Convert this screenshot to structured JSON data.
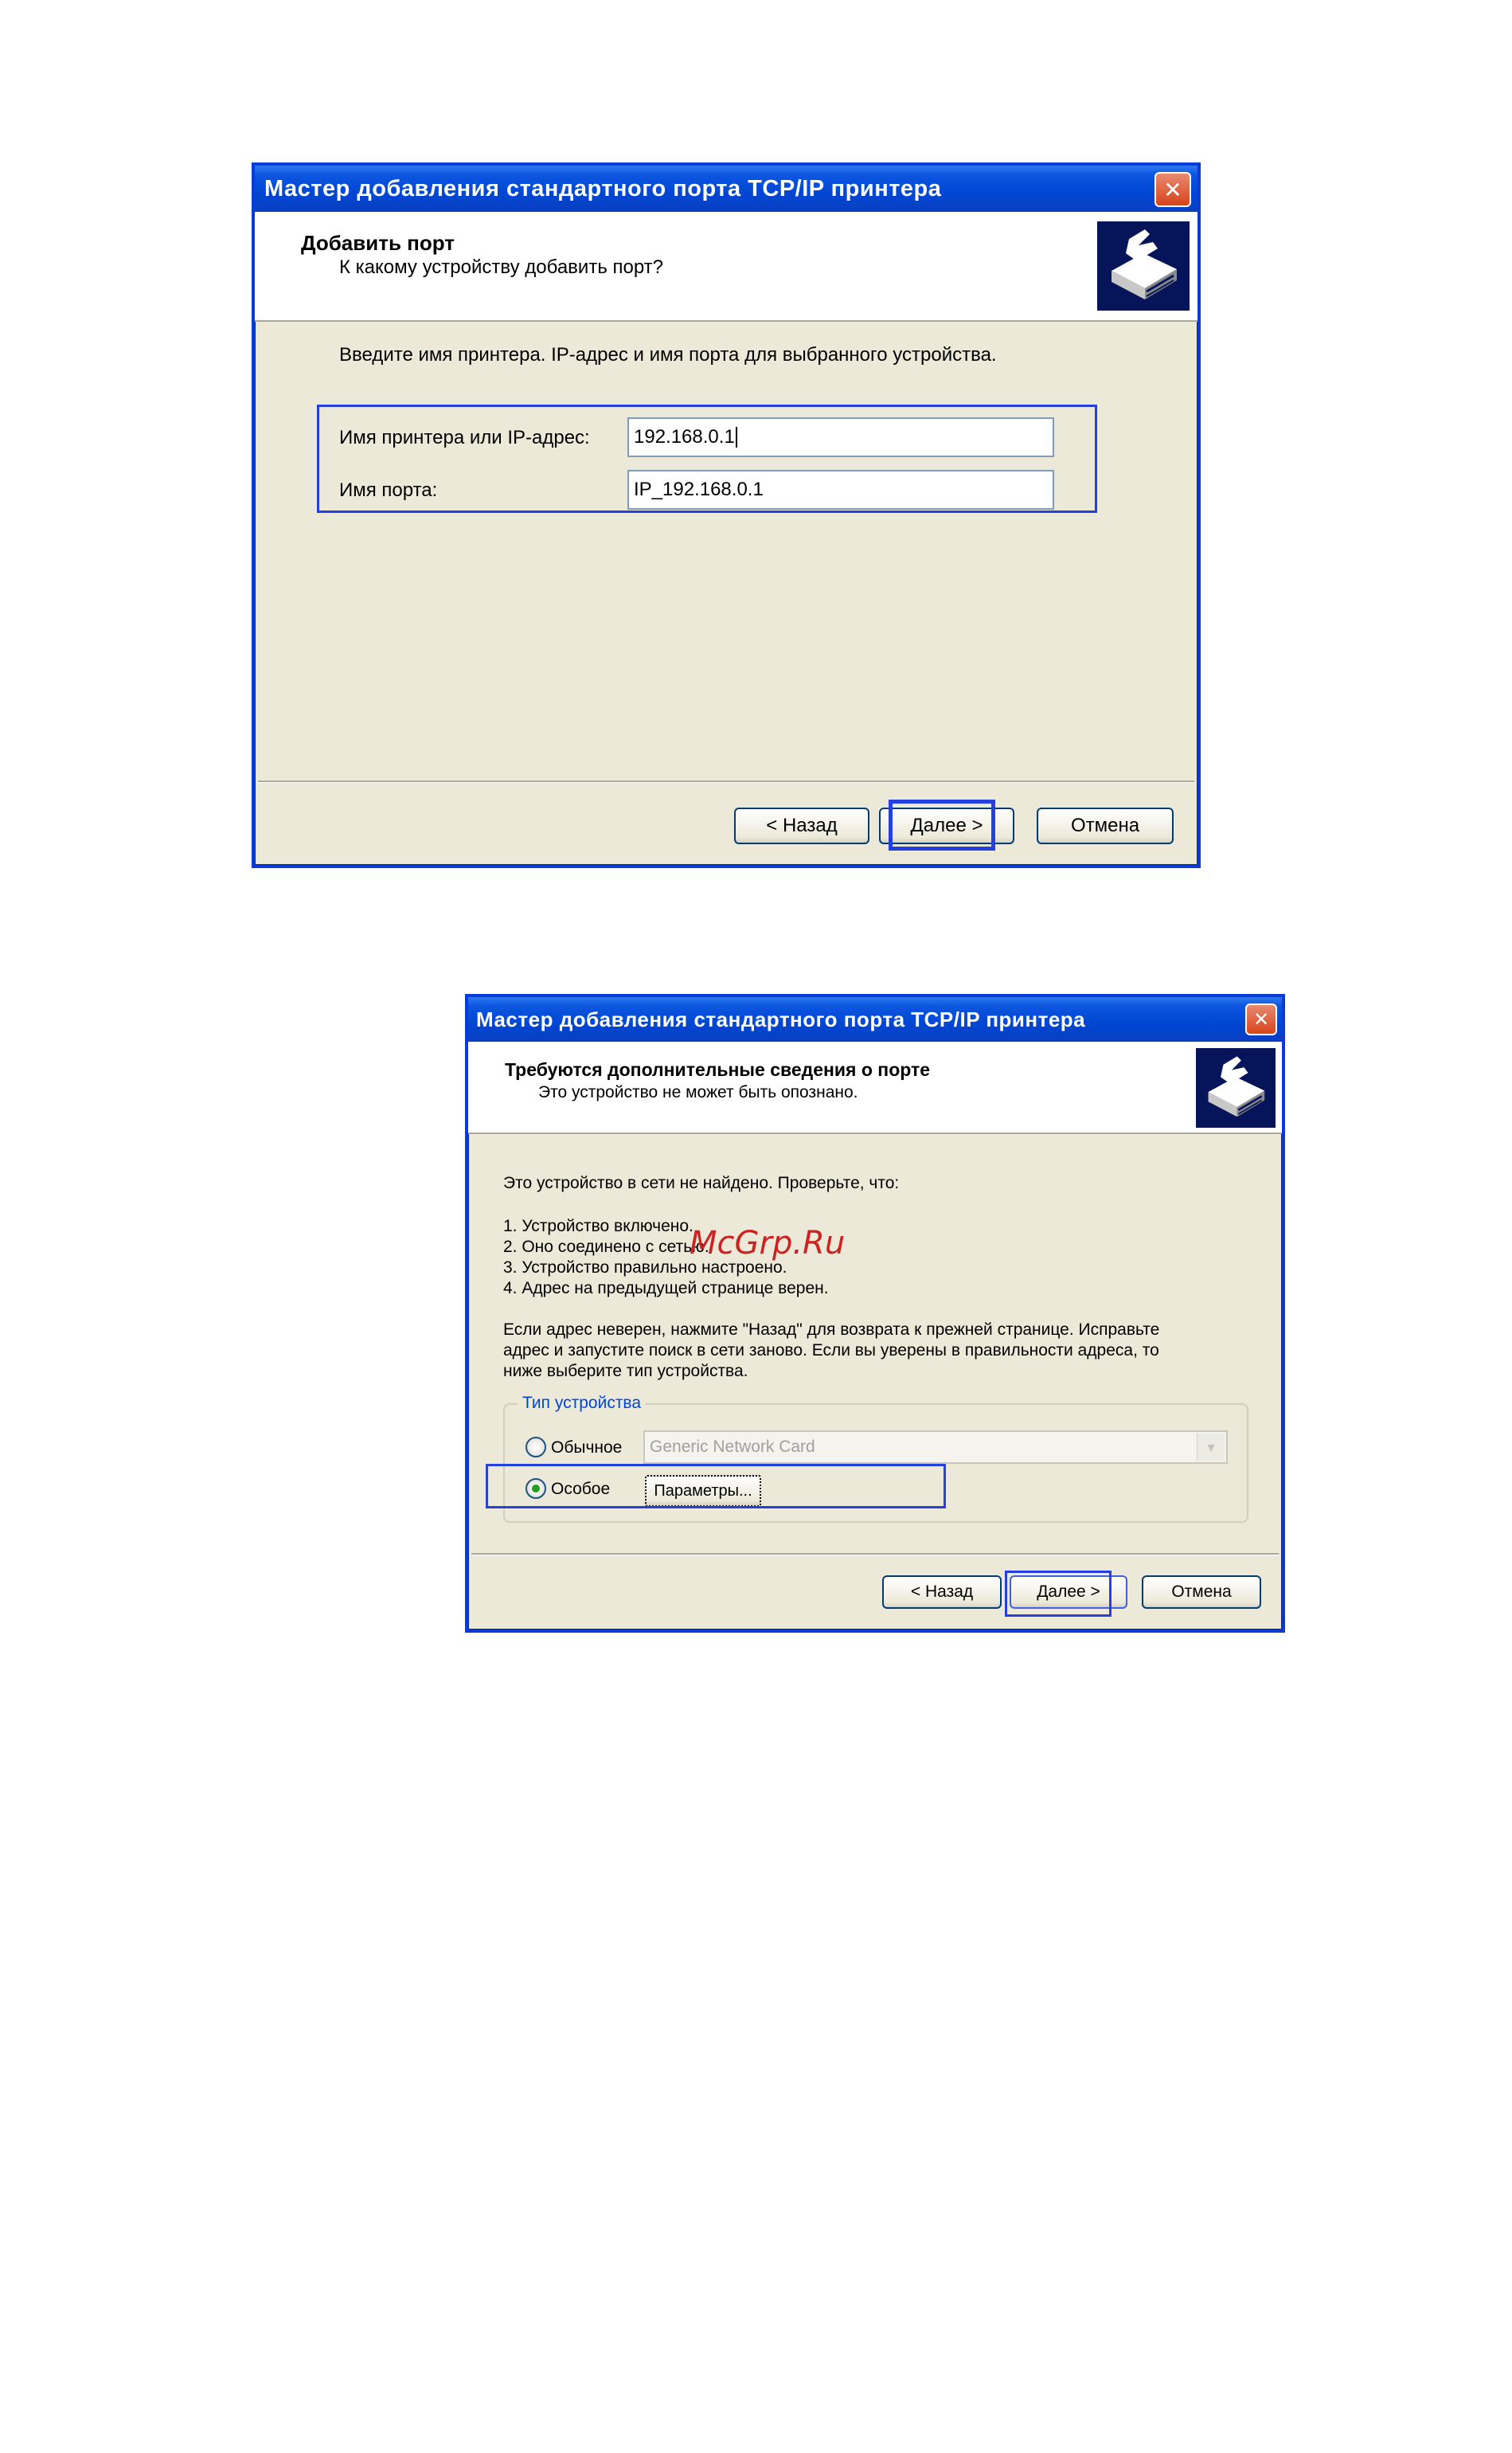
{
  "dialog1": {
    "title": "Мастер добавления стандартного порта TCP/IP принтера",
    "close_glyph": "✕",
    "header_title": "Добавить порт",
    "header_subtitle": "К какому устройству добавить порт?",
    "header_icon": "printer-wizard-icon",
    "instruction": "Введите имя принтера. IP-адрес и имя порта для выбранного устройства.",
    "printer_label": "Имя принтера или IP-адрес:",
    "printer_value": "192.168.0.1",
    "port_label": "Имя порта:",
    "port_value": "IP_192.168.0.1",
    "back_label": "< Назад",
    "next_label": "Далее >",
    "cancel_label": "Отмена"
  },
  "dialog2": {
    "title": "Мастер добавления стандартного порта TCP/IP принтера",
    "close_glyph": "✕",
    "header_title": "Требуются дополнительные сведения о порте",
    "header_subtitle": "Это устройство не может быть опознано.",
    "header_icon": "printer-wizard-icon",
    "intro": "Это устройство в сети не найдено. Проверьте, что:",
    "checks": [
      "1.  Устройство включено.",
      "2.  Оно соединено с сетью.",
      "3.  Устройство правильно настроено.",
      "4.  Адрес на предыдущей странице верен."
    ],
    "advice_lines": [
      "Если адрес неверен, нажмите \"Назад\" для возврата к прежней странице.  Исправьте",
      "адрес и запустите поиск в сети заново.  Если вы уверены в правильности адреса, то",
      "ниже выберите тип устройства."
    ],
    "group_label": "Тип устройства",
    "radio_standard_label": "Обычное",
    "standard_select_value": "Generic Network Card",
    "radio_custom_label": "Особое",
    "settings_button_label": "Параметры...",
    "selected_radio": "custom",
    "back_label": "< Назад",
    "next_label": "Далее >",
    "cancel_label": "Отмена"
  },
  "watermark": "McGrp.Ru",
  "colors": {
    "titlebar": "#0046d4",
    "dialog_bg": "#ece9d8",
    "highlight": "#2440e0",
    "watermark": "#cc2222"
  }
}
